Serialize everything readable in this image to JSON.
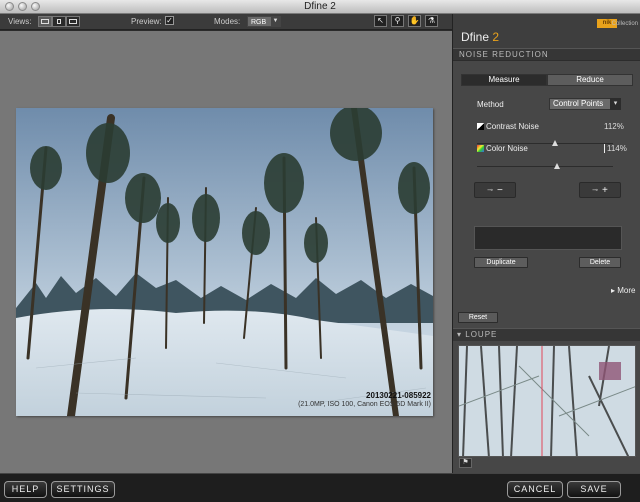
{
  "window": {
    "title": "Dfine 2"
  },
  "toolbar": {
    "views_label": "Views:",
    "preview_label": "Preview:",
    "preview_checked": "✓",
    "modes_label": "Modes:",
    "mode_value": "RGB",
    "tool_icons": [
      "arrow-icon",
      "zoom-icon",
      "hand-icon",
      "eyedropper-icon"
    ]
  },
  "photo": {
    "caption": "20130221-085922",
    "meta": "(21.0MP, ISO 100, Canon EOS 5D Mark II)"
  },
  "panel": {
    "brand_name": "Dfine",
    "brand_version": "2",
    "nik_logo": "nik",
    "collection": "Collection",
    "section_title": "NOISE REDUCTION",
    "tabs": [
      "Measure",
      "Reduce"
    ],
    "method_label": "Method",
    "method_value": "Control Points",
    "contrast_label": "Contrast Noise",
    "contrast_value": "112%",
    "color_label": "Color Noise",
    "color_value": "114%",
    "duplicate_label": "Duplicate",
    "delete_label": "Delete",
    "more_label": "More",
    "reset_label": "Reset",
    "loupe_title": "LOUPE"
  },
  "bottom": {
    "help": "HELP",
    "settings": "SETTINGS",
    "cancel": "CANCEL",
    "save": "SAVE"
  },
  "colors": {
    "accent": "#e9a21b",
    "panel_bg": "#474747",
    "canvas_bg": "#777777"
  }
}
